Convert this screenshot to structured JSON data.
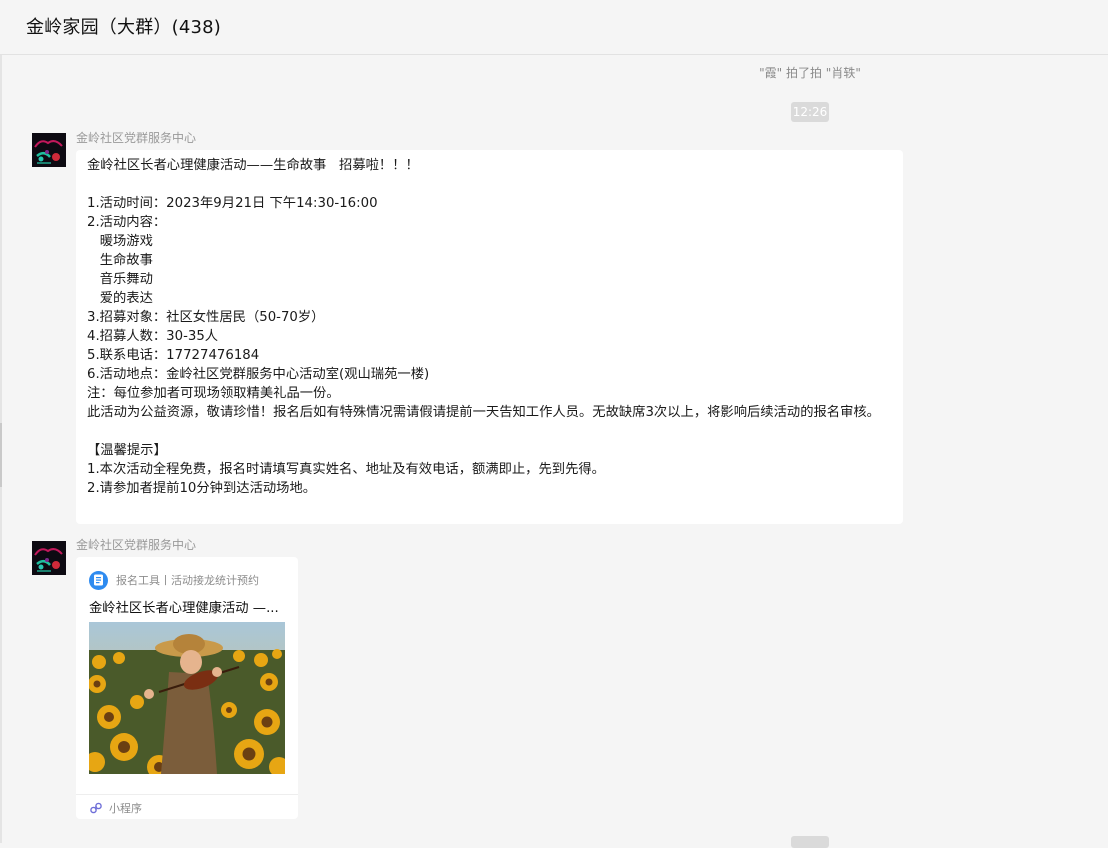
{
  "chat": {
    "title": "金岭家园（大群）(438)"
  },
  "system_notice": "\"霞\" 拍了拍 \"肖轶\"",
  "timestamp": "12:26",
  "messages": [
    {
      "sender": "金岭社区党群服务中心",
      "text": "金岭社区长者心理健康活动——生命故事   招募啦！！！\n\n1.活动时间：2023年9月21日 下午14:30-16:00\n2.活动内容：\n   暖场游戏\n   生命故事\n   音乐舞动\n   爱的表达\n3.招募对象：社区女性居民（50-70岁）\n4.招募人数：30-35人\n5.联系电话：17727476184\n6.活动地点：金岭社区党群服务中心活动室(观山瑞苑一楼)\n注：每位参加者可现场领取精美礼品一份。\n此活动为公益资源，敬请珍惜！报名后如有特殊情况需请假请提前一天告知工作人员。无故缺席3次以上，将影响后续活动的报名审核。\n\n【温馨提示】\n1.本次活动全程免费，报名时请填写真实姓名、地址及有效电话，额满即止，先到先得。\n2.请参加者提前10分钟到达活动场地。"
    },
    {
      "sender": "金岭社区党群服务中心",
      "card": {
        "source": "报名工具丨活动接龙统计预约",
        "title": "金岭社区长者心理健康活动 —...",
        "footer": "小程序"
      }
    }
  ],
  "colors": {
    "background": "#f5f5f5",
    "bubble": "#ffffff",
    "meta_text": "#999999",
    "app_icon": "#2e8bf0"
  }
}
